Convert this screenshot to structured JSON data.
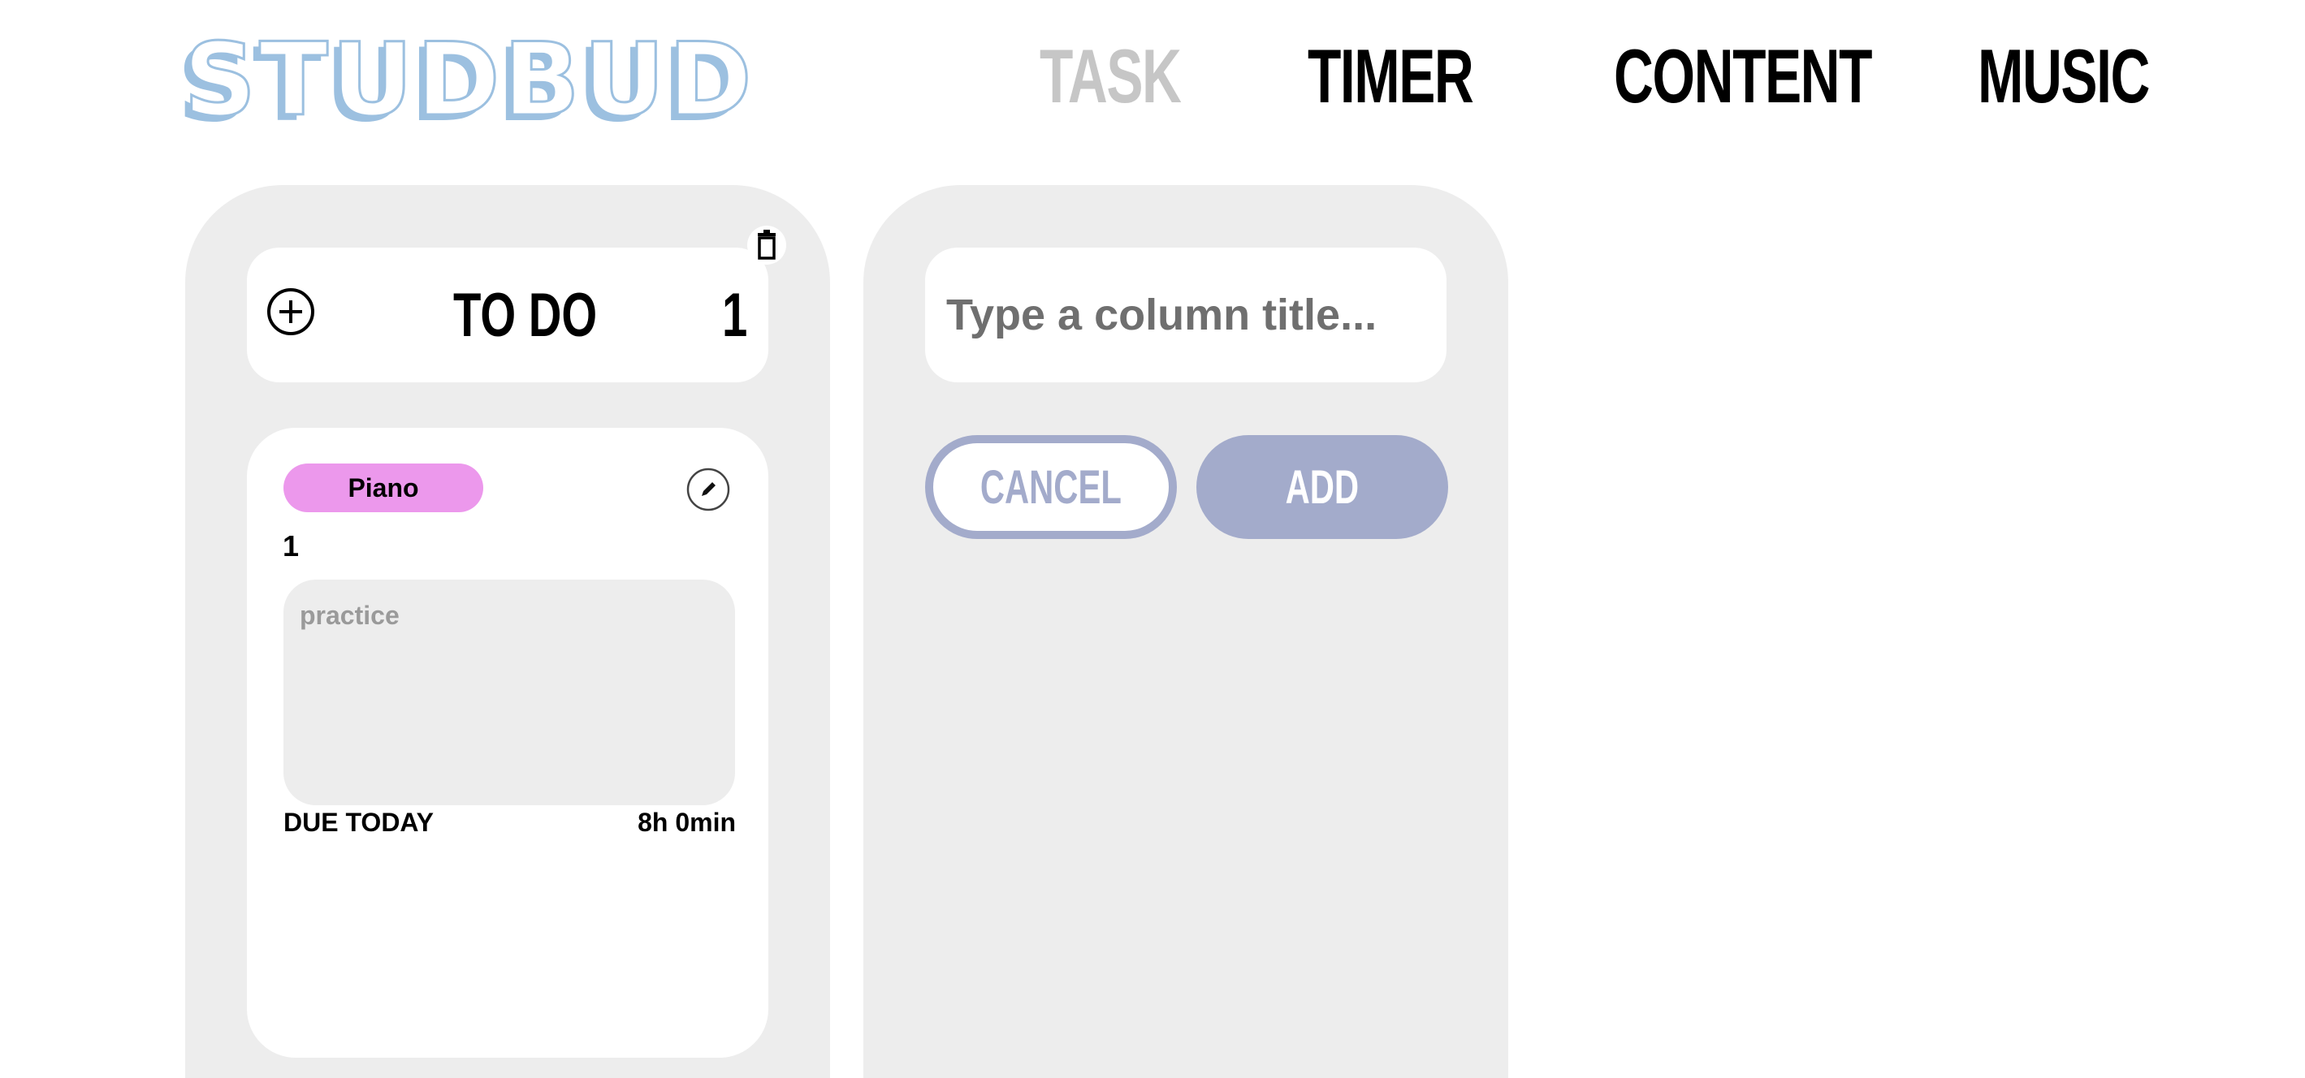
{
  "app": {
    "logo_text": "STUDBUD"
  },
  "nav": {
    "items": [
      {
        "label": "TASK",
        "active": true
      },
      {
        "label": "TIMER",
        "active": false
      },
      {
        "label": "CONTENT",
        "active": false
      },
      {
        "label": "MUSIC",
        "active": false
      }
    ]
  },
  "columns": [
    {
      "title": "TO DO",
      "count": "1",
      "tasks": [
        {
          "tag": "Piano",
          "title": "1",
          "description": "practice",
          "due": "DUE TODAY",
          "duration": "8h 0min"
        }
      ]
    }
  ],
  "new_column": {
    "placeholder": "Type a column title...",
    "value": "",
    "cancel_label": "CANCEL",
    "add_label": "ADD"
  },
  "icons": {
    "add": "plus-circle-icon",
    "delete": "trash-icon",
    "edit": "pencil-icon"
  },
  "colors": {
    "logo": "#9cc0e0",
    "nav_active": "#c6c6c6",
    "column_bg": "#ededed",
    "tag": "#ec98ec",
    "button": "#a3abcb"
  }
}
